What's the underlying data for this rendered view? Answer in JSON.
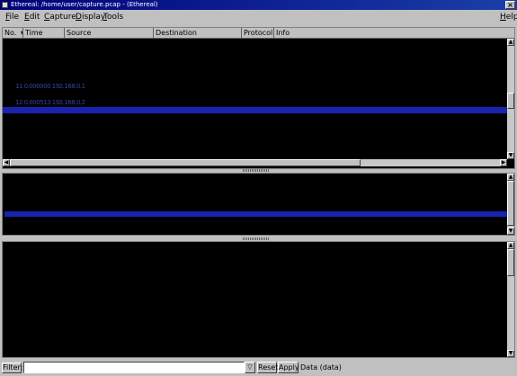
{
  "window": {
    "title": "Ethereal: /home/user/capture.pcap - (Ethereal)",
    "close_glyph": "×"
  },
  "menu": {
    "file": "File",
    "edit": "Edit",
    "capture": "Capture",
    "display": "Display",
    "tools": "Tools",
    "help": "Help"
  },
  "packet_list": {
    "columns": [
      "No.",
      "Time",
      "Source",
      "Destination",
      "Protocol",
      "Info"
    ],
    "sort_indicator": "▾",
    "rows": [
      {
        "text": "11 0.000000 192.168.0.1"
      },
      {
        "text": "12 0.000513 192.168.0.2"
      }
    ]
  },
  "filter_bar": {
    "filter_label": "Filter:",
    "filter_value": "",
    "reset_label": "Reset",
    "apply_label": "Apply",
    "status": "Data (data)"
  },
  "colors": {
    "selection": "#1a22b0",
    "pane_background": "#000000",
    "chrome": "#c0c0c0",
    "title_bar": "#00007b"
  },
  "icons": {
    "close": "close-icon",
    "scroll_up": "arrow-up-icon",
    "scroll_down": "arrow-down-icon",
    "scroll_left": "arrow-left-icon",
    "scroll_right": "arrow-right-icon",
    "dropdown": "chevron-down-icon"
  }
}
